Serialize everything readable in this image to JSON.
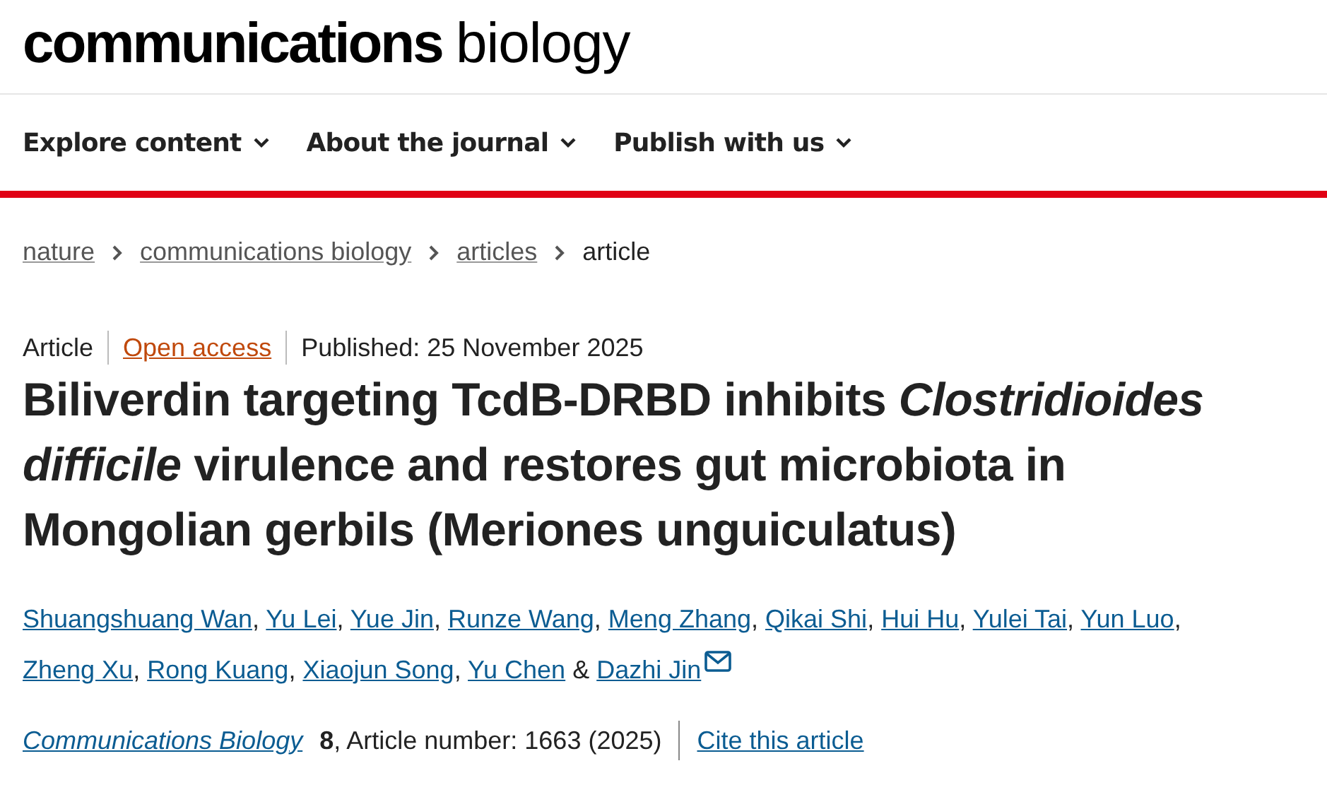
{
  "logo": {
    "bold": "communications",
    "light": "biology"
  },
  "nav": [
    {
      "label": "Explore content",
      "expanded": false
    },
    {
      "label": "About the journal",
      "expanded": false
    },
    {
      "label": "Publish with us",
      "expanded": false
    }
  ],
  "breadcrumbs": [
    {
      "label": "nature",
      "current": false
    },
    {
      "label": "communications biology",
      "current": false
    },
    {
      "label": "articles",
      "current": false
    },
    {
      "label": "article",
      "current": true
    }
  ],
  "meta": {
    "type": "Article",
    "access": "Open access",
    "published": "Published: 25 November 2025"
  },
  "title": "Biliverdin targeting TcdB-DRBD inhibits *Clostridioides difficile* virulence and restores gut microbiota in Mongolian gerbils (Meriones unguiculatus)",
  "authors": [
    {
      "name": "Shuangshuang Wan",
      "sep": ",",
      "corresponding": false
    },
    {
      "name": "Yu Lei",
      "sep": ",",
      "corresponding": false
    },
    {
      "name": "Yue Jin",
      "sep": ",",
      "corresponding": false
    },
    {
      "name": "Runze Wang",
      "sep": ",",
      "corresponding": false
    },
    {
      "name": "Meng Zhang",
      "sep": ",",
      "corresponding": false
    },
    {
      "name": "Qikai Shi",
      "sep": ",",
      "corresponding": false
    },
    {
      "name": "Hui Hu",
      "sep": ",",
      "corresponding": false
    },
    {
      "name": "Yulei Tai",
      "sep": ",",
      "corresponding": false
    },
    {
      "name": "Yun Luo",
      "sep": ",",
      "corresponding": false
    },
    {
      "name": "Zheng Xu",
      "sep": ",",
      "corresponding": false
    },
    {
      "name": "Rong Kuang",
      "sep": ",",
      "corresponding": false
    },
    {
      "name": "Xiaojun Song",
      "sep": ",",
      "corresponding": false
    },
    {
      "name": "Yu Chen",
      "sep": "&",
      "corresponding": false
    },
    {
      "name": "Dazhi Jin",
      "corresponding": true
    }
  ],
  "citation": {
    "journal": "Communications Biology",
    "details": "**8**, Article number: 1663 (2025)",
    "cite": "Cite this article"
  }
}
